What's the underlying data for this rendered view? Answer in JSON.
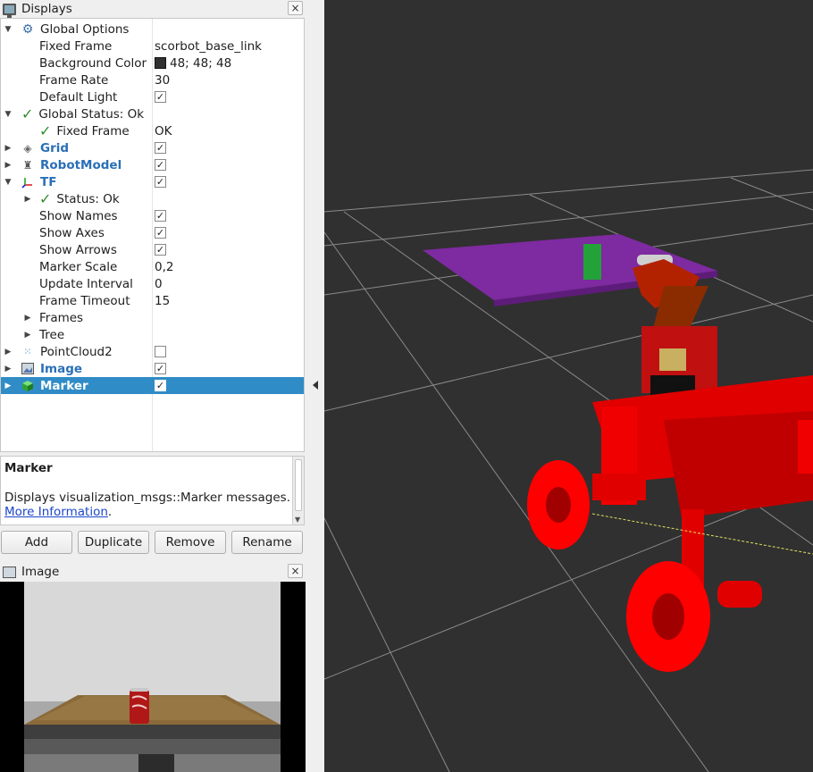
{
  "displays_panel": {
    "title": "Displays",
    "close": "×",
    "tree": [
      {
        "label": "Global Options",
        "value": ""
      },
      {
        "label": "Fixed Frame",
        "value": "scorbot_base_link"
      },
      {
        "label": "Background Color",
        "value": "48; 48; 48"
      },
      {
        "label": "Frame Rate",
        "value": "30"
      },
      {
        "label": "Default Light",
        "value": ""
      },
      {
        "label": "Global Status: Ok",
        "value": ""
      },
      {
        "label": "Fixed Frame",
        "value": "OK"
      },
      {
        "label": "Grid",
        "value": ""
      },
      {
        "label": "RobotModel",
        "value": ""
      },
      {
        "label": "TF",
        "value": ""
      },
      {
        "label": "Status: Ok",
        "value": ""
      },
      {
        "label": "Show Names",
        "value": ""
      },
      {
        "label": "Show Axes",
        "value": ""
      },
      {
        "label": "Show Arrows",
        "value": ""
      },
      {
        "label": "Marker Scale",
        "value": "0,2"
      },
      {
        "label": "Update Interval",
        "value": "0"
      },
      {
        "label": "Frame Timeout",
        "value": "15"
      },
      {
        "label": "Frames",
        "value": ""
      },
      {
        "label": "Tree",
        "value": ""
      },
      {
        "label": "PointCloud2",
        "value": ""
      },
      {
        "label": "Image",
        "value": ""
      },
      {
        "label": "Marker",
        "value": ""
      }
    ],
    "checkbox_states": {
      "default_light": true,
      "grid": true,
      "robotmodel": true,
      "tf": true,
      "show_names": true,
      "show_axes": true,
      "show_arrows": true,
      "pointcloud2": false,
      "image": true,
      "marker": true
    },
    "background_color_hex": "#303030"
  },
  "description": {
    "title": "Marker",
    "text": "Displays visualization_msgs::Marker messages.",
    "link": "More Information",
    "link_suffix": "."
  },
  "buttons": {
    "add": "Add",
    "duplicate": "Duplicate",
    "remove": "Remove",
    "rename": "Rename"
  },
  "image_panel": {
    "title": "Image",
    "close": "×"
  },
  "colors": {
    "selection": "#308cc6",
    "link": "#1a47c9",
    "status_ok": "#2e8b2e",
    "viewport_bg": "#303030",
    "robot": "#ff0000"
  }
}
